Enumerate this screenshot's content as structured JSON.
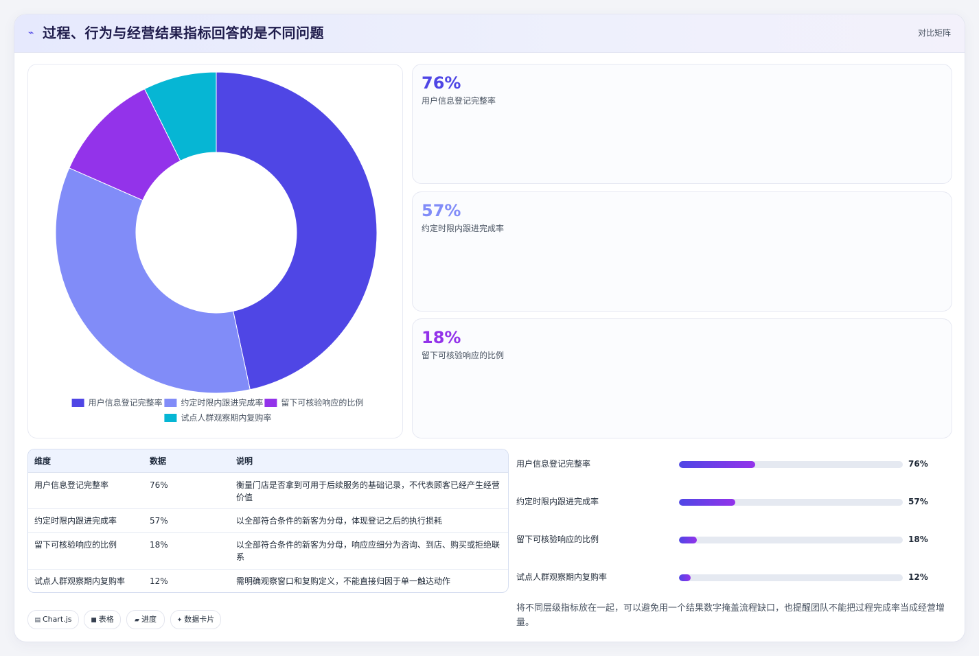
{
  "header": {
    "icon": "pulse-icon",
    "title": "过程、行为与经营结果指标回答的是不同问题",
    "tag": "对比矩阵"
  },
  "chart_data": {
    "type": "pie",
    "categories": [
      "用户信息登记完整率",
      "约定时限内跟进完成率",
      "留下可核验响应的比例",
      "试点人群观察期内复购率"
    ],
    "values": [
      76,
      57,
      18,
      12
    ],
    "colors": [
      "#4f46e5",
      "#818cf8",
      "#9333ea",
      "#06b6d4"
    ],
    "legend_position": "bottom"
  },
  "kpis": [
    {
      "value": "76%",
      "label": "用户信息登记完整率",
      "color": "#4f46e5"
    },
    {
      "value": "57%",
      "label": "约定时限内跟进完成率",
      "color": "#818cf8"
    },
    {
      "value": "18%",
      "label": "留下可核验响应的比例",
      "color": "#9333ea"
    }
  ],
  "table": {
    "headers": [
      "维度",
      "数据",
      "说明"
    ],
    "rows": [
      {
        "dim": "用户信息登记完整率",
        "val": "76%",
        "desc": "衡量门店是否拿到可用于后续服务的基础记录，不代表顾客已经产生经营价值"
      },
      {
        "dim": "约定时限内跟进完成率",
        "val": "57%",
        "desc": "以全部符合条件的新客为分母，体现登记之后的执行损耗"
      },
      {
        "dim": "留下可核验响应的比例",
        "val": "18%",
        "desc": "以全部符合条件的新客为分母，响应应细分为咨询、到店、购买或拒绝联系"
      },
      {
        "dim": "试点人群观察期内复购率",
        "val": "12%",
        "desc": "需明确观察窗口和复购定义，不能直接归因于单一触达动作"
      }
    ]
  },
  "progress": [
    {
      "label": "用户信息登记完整率",
      "display": "76%",
      "fraction": 0.34
    },
    {
      "label": "约定时限内跟进完成率",
      "display": "57%",
      "fraction": 0.25
    },
    {
      "label": "留下可核验响应的比例",
      "display": "18%",
      "fraction": 0.08
    },
    {
      "label": "试点人群观察期内复购率",
      "display": "12%",
      "fraction": 0.053
    }
  ],
  "note": "将不同层级指标放在一起，可以避免用一个结果数字掩盖流程缺口，也提醒团队不能把过程完成率当成经营增量。",
  "chips": [
    {
      "icon": "chart-icon",
      "label": "Chart.js"
    },
    {
      "icon": "table-icon",
      "label": "表格"
    },
    {
      "icon": "progress-icon",
      "label": "进度"
    },
    {
      "icon": "sparkle-icon",
      "label": "数据卡片"
    }
  ]
}
